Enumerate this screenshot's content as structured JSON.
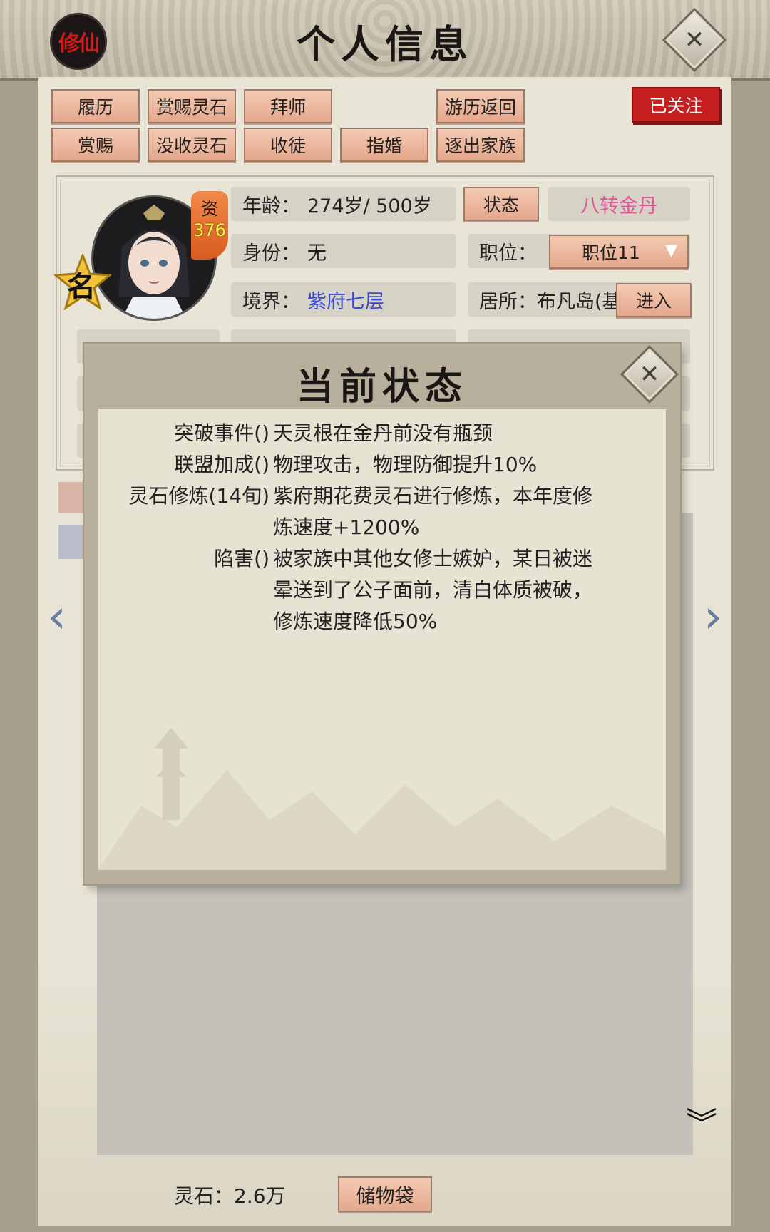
{
  "header": {
    "logo_text": "修仙",
    "title": "个人信息"
  },
  "action_buttons": [
    {
      "label": "履历"
    },
    {
      "label": "赏赐灵石"
    },
    {
      "label": "拜师"
    },
    {
      "label": "游历返回"
    },
    {
      "label": "赏赐"
    },
    {
      "label": "没收灵石"
    },
    {
      "label": "收徒"
    },
    {
      "label": "指婚"
    },
    {
      "label": "逐出家族"
    }
  ],
  "follow_button": "已关注",
  "profile": {
    "star_badge": "名",
    "aptitude_label": "资",
    "aptitude_value": "376",
    "age_label": "年龄：",
    "age_value": "274岁/ 500岁",
    "status_button": "状态",
    "title_value": "八转金丹",
    "identity_label": "身份：",
    "identity_value": "无",
    "position_label": "职位：",
    "position_select": "职位11",
    "realm_label": "境界：",
    "realm_value": "紫府七层",
    "residence_label": "居所：",
    "residence_value": "布凡岛(基",
    "enter_button": "进入"
  },
  "footer": {
    "spirit_stone": "灵石：2.6万",
    "storage_button": "储物袋"
  },
  "modal": {
    "title": "当前状态",
    "items": [
      {
        "name": "突破事件()",
        "lines": [
          "天灵根在金丹前没有瓶颈"
        ]
      },
      {
        "name": "联盟加成()",
        "lines": [
          "物理攻击，物理防御提升10%"
        ]
      },
      {
        "name": "灵石修炼(14旬)",
        "lines": [
          "紫府期花费灵石进行修炼，本年度修",
          "炼速度+1200%"
        ]
      },
      {
        "name": "陷害()",
        "lines": [
          "被家族中其他女修士嫉妒，某日被迷",
          "晕送到了公子面前，清白体质被破，",
          "修炼速度降低50%"
        ]
      }
    ]
  },
  "colors": {
    "follow_red": "#c51f1f",
    "title_pink": "#e0559a",
    "realm_blue": "#3a48d6",
    "button_peach": "#efb9a0"
  }
}
